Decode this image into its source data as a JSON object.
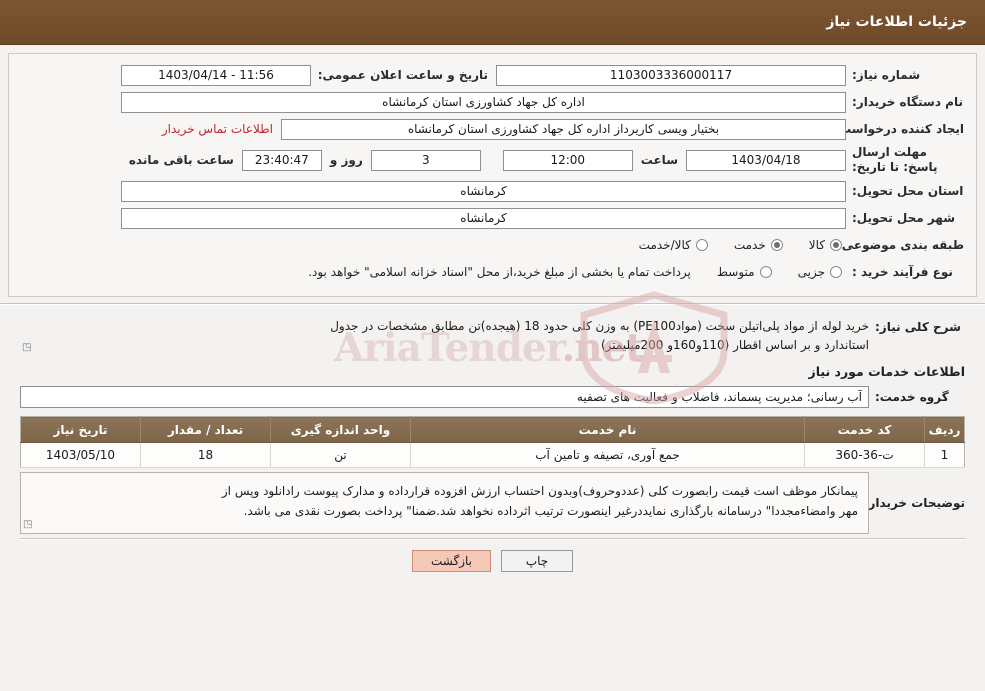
{
  "header": {
    "title": "جزئیات اطلاعات نیاز"
  },
  "form": {
    "need_number_label": "شماره نیاز:",
    "need_number_value": "1103003336000117",
    "announce_datetime_label": "تاریخ و ساعت اعلان عمومی:",
    "announce_datetime_value": "1403/04/14 - 11:56",
    "buyer_org_label": "نام دستگاه خریدار:",
    "buyer_org_value": "اداره کل جهاد کشاورزی استان کرمانشاه",
    "requester_label": "ایجاد کننده درخواست:",
    "requester_value": "بختیار ویسی کاریرداز اداره کل جهاد کشاورزی استان کرمانشاه",
    "contact_link": "اطلاعات تماس خریدار",
    "deadline_label": "مهلت ارسال پاسخ: تا تاریخ:",
    "deadline_date": "1403/04/18",
    "hour_label": "ساعت",
    "deadline_hour": "12:00",
    "days_value": "3",
    "days_label": "روز و",
    "countdown_value": "23:40:47",
    "remaining_label": "ساعت باقی مانده",
    "province_label": "استان محل تحویل:",
    "province_value": "کرمانشاه",
    "city_label": "شهر محل تحویل:",
    "city_value": "کرمانشاه",
    "category_label": "طبقه بندی موضوعی:",
    "category_options": [
      "کالا",
      "خدمت",
      "کالا/خدمت"
    ],
    "category_selected": "کالا",
    "process_label": "نوع فرآیند خرید :",
    "process_options": [
      "جزیی",
      "متوسط"
    ],
    "process_selected": "",
    "process_note": "پرداخت تمام یا بخشی از مبلغ خرید،از محل \"اسناد خزانه اسلامی\" خواهد بود."
  },
  "watermark": {
    "text": "AriaTender",
    "suffix": ".net"
  },
  "description": {
    "label": "شرح کلی نیاز:",
    "line1": "خرید لوله از مواد پلی‌اتیلن سخت (موادPE100) به وزن کلی حدود 18 (هیجده)تن مطابق مشخصات  در جدول",
    "line2": "استاندارد و بر اساس اقطار (110و160و 200میلیمتر)"
  },
  "services_section": {
    "heading": "اطلاعات خدمات مورد نیاز",
    "group_label": "گروه خدمت:",
    "group_value": "آب رسانی؛ مدیریت پسماند، فاضلاب و فعالیت های تصفیه",
    "columns": [
      "ردیف",
      "کد خدمت",
      "نام خدمت",
      "واحد اندازه گیری",
      "تعداد / مقدار",
      "تاریخ نیاز"
    ],
    "rows": [
      {
        "index": "1",
        "code": "ت-36-360",
        "name": "جمع آوری، تصیفه و تامین آب",
        "unit": "تن",
        "quantity": "18",
        "date": "1403/05/10"
      }
    ]
  },
  "buyer_notes": {
    "label": "توضیحات خریدار:",
    "line1": "پیمانکار موظف است قیمت رابصورت کلی (عددوحروف)وبدون احتساب ارزش افزوده قرارداده و مدارک پیوست رادانلود وپس از",
    "line2": "مهر وامضاءمجددا\" درسامانه بارگذاری نمایددرغیر اینصورت ترتیب اثرداده نخواهد شد.ضمنا\" پرداخت بصورت نقدی می باشد."
  },
  "footer": {
    "print_label": "چاپ",
    "back_label": "بازگشت"
  }
}
